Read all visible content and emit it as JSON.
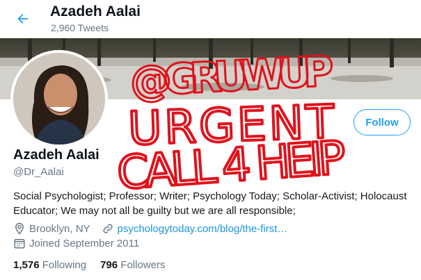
{
  "header": {
    "title": "Azadeh Aalai",
    "tweet_count": "2,960 Tweets"
  },
  "profile": {
    "name": "Azadeh Aalai",
    "handle": "@Dr_Aalai",
    "bio": "Social Psychologist; Professor; Writer; Psychology Today; Scholar-Activist; Holocaust Educator; We may not all be guilty but we are all responsible;",
    "location": "Brooklyn, NY",
    "website": "psychologytoday.com/blog/the-first…",
    "joined": "Joined September 2011",
    "follow_label": "Follow"
  },
  "stats": {
    "following_count": "1,576",
    "following_label": "Following",
    "followers_count": "796",
    "followers_label": "Followers"
  },
  "annotation": {
    "lines": [
      "@GRUWUP",
      "URGENT",
      "CALL 4 HEIP"
    ],
    "color": "#e0121c"
  },
  "colors": {
    "accent": "#1da1f2",
    "link": "#1b95e0",
    "secondary_text": "#657786"
  },
  "icons": [
    "back-arrow-icon",
    "location-icon",
    "link-icon",
    "calendar-icon"
  ]
}
